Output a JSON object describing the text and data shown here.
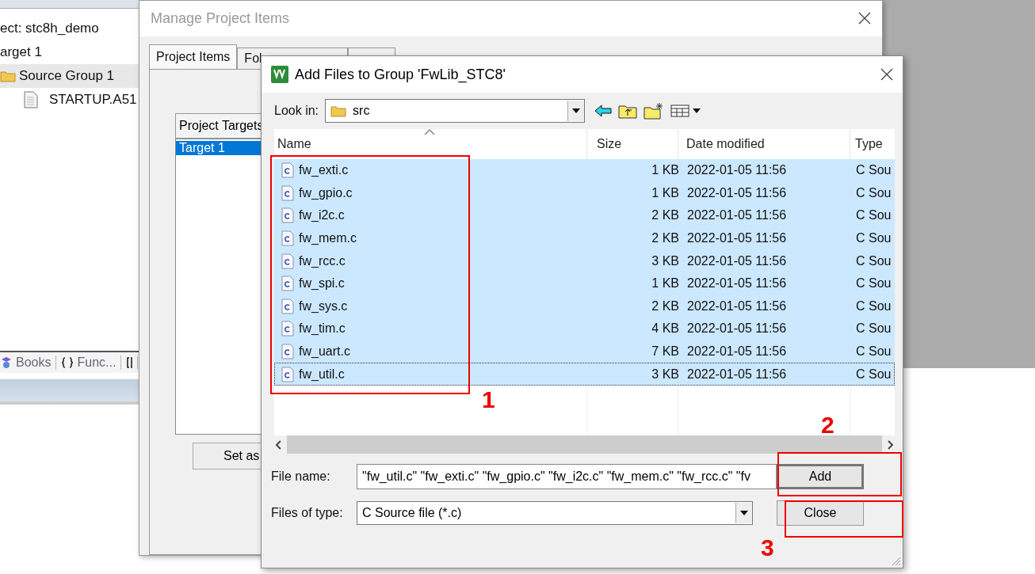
{
  "project_panel": {
    "tree": [
      {
        "label": "ect: stc8h_demo",
        "selected": false,
        "children": [
          {
            "label": "arget 1",
            "selected": false,
            "children": [
              {
                "label": "Source Group 1",
                "selected": true,
                "children": [
                  {
                    "label": "STARTUP.A51",
                    "selected": false
                  }
                ]
              }
            ]
          }
        ]
      }
    ],
    "tabs": [
      {
        "label": "Books",
        "kind": "books"
      },
      {
        "label": "Func...",
        "kind": "functions"
      },
      {
        "kind": "templates"
      }
    ]
  },
  "manage_dialog": {
    "title": "Manage Project Items",
    "tabs": [
      {
        "label": "Project Items",
        "selected": true
      },
      {
        "label": "Fol",
        "selected": false
      },
      {
        "selected": false
      }
    ],
    "targets": {
      "header": "Project Targets",
      "items": [
        {
          "label": "Target 1",
          "selected": true
        }
      ]
    },
    "button": "Set as"
  },
  "add_dialog": {
    "title": "Add Files to Group 'FwLib_STC8'",
    "look_in": {
      "label": "Look in:",
      "value": "src"
    },
    "columns": [
      {
        "label": "Name",
        "sorted": true
      },
      {
        "label": "Size",
        "sorted": false
      },
      {
        "label": "Date modified",
        "sorted": false
      },
      {
        "label": "Type",
        "sorted": false
      }
    ],
    "rows": [
      {
        "name": "fw_exti.c",
        "size": "1 KB",
        "date": "2022-01-05 11:56",
        "type": "C Sou",
        "selected": true,
        "focused": false
      },
      {
        "name": "fw_gpio.c",
        "size": "1 KB",
        "date": "2022-01-05 11:56",
        "type": "C Sou",
        "selected": true,
        "focused": false
      },
      {
        "name": "fw_i2c.c",
        "size": "2 KB",
        "date": "2022-01-05 11:56",
        "type": "C Sou",
        "selected": true,
        "focused": false
      },
      {
        "name": "fw_mem.c",
        "size": "2 KB",
        "date": "2022-01-05 11:56",
        "type": "C Sou",
        "selected": true,
        "focused": false
      },
      {
        "name": "fw_rcc.c",
        "size": "3 KB",
        "date": "2022-01-05 11:56",
        "type": "C Sou",
        "selected": true,
        "focused": false
      },
      {
        "name": "fw_spi.c",
        "size": "1 KB",
        "date": "2022-01-05 11:56",
        "type": "C Sou",
        "selected": true,
        "focused": false
      },
      {
        "name": "fw_sys.c",
        "size": "2 KB",
        "date": "2022-01-05 11:56",
        "type": "C Sou",
        "selected": true,
        "focused": false
      },
      {
        "name": "fw_tim.c",
        "size": "4 KB",
        "date": "2022-01-05 11:56",
        "type": "C Sou",
        "selected": true,
        "focused": false
      },
      {
        "name": "fw_uart.c",
        "size": "7 KB",
        "date": "2022-01-05 11:56",
        "type": "C Sou",
        "selected": true,
        "focused": false
      },
      {
        "name": "fw_util.c",
        "size": "3 KB",
        "date": "2022-01-05 11:56",
        "type": "C Sou",
        "selected": true,
        "focused": true
      }
    ],
    "file_name": {
      "label": "File name:",
      "value": "\"fw_util.c\" \"fw_exti.c\" \"fw_gpio.c\" \"fw_i2c.c\" \"fw_mem.c\" \"fw_rcc.c\" \"fv"
    },
    "file_type": {
      "label": "Files of type:",
      "value": "C Source file (*.c)"
    },
    "buttons": [
      {
        "label": "Add",
        "default": true
      },
      {
        "label": "Close",
        "default": false
      }
    ]
  },
  "annotations": [
    {
      "label": "1"
    },
    {
      "label": "2"
    },
    {
      "label": "3"
    }
  ]
}
